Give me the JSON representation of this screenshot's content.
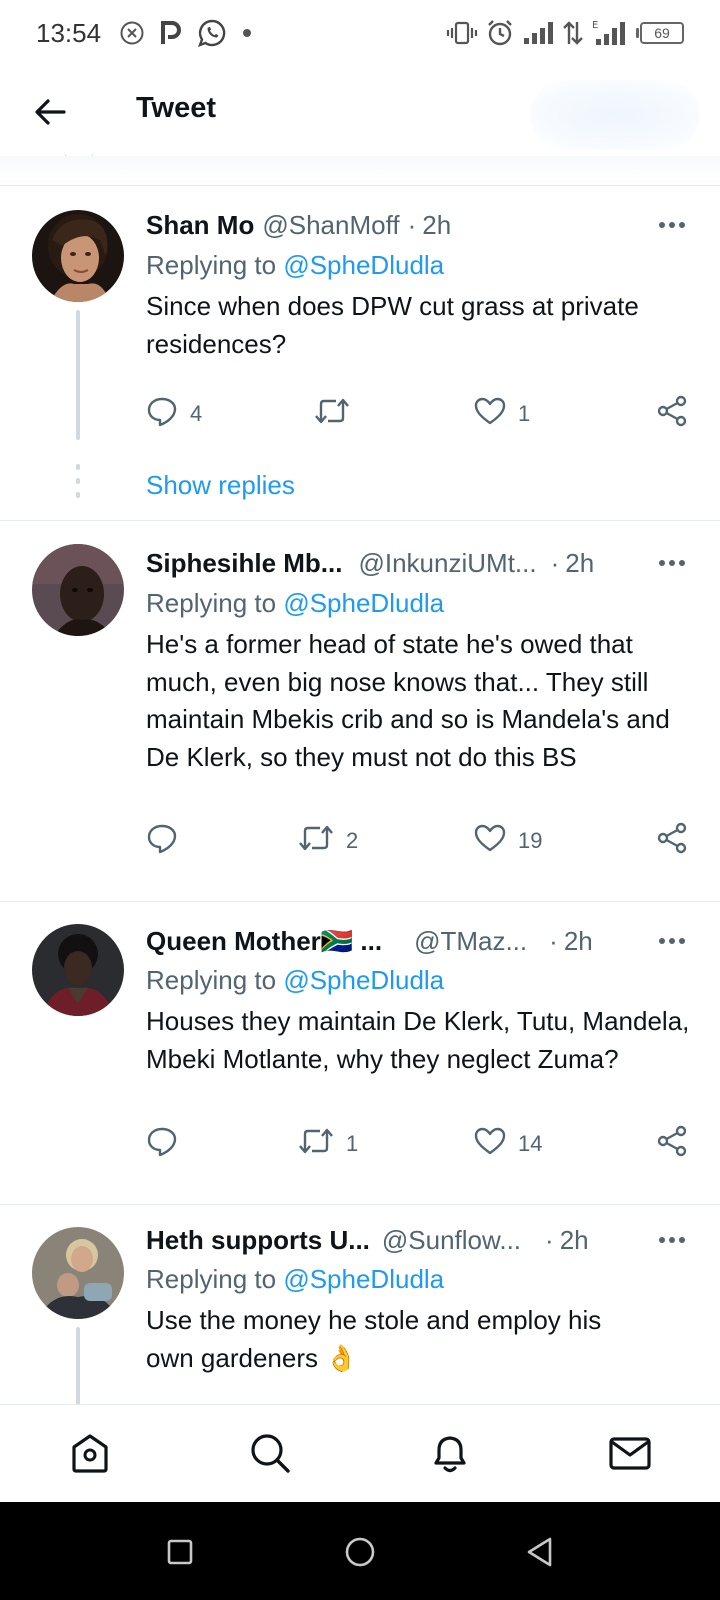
{
  "status_bar": {
    "time": "13:54",
    "battery": "69",
    "icons": [
      "close-circle-icon",
      "p-app-icon",
      "whatsapp-icon",
      "dot-icon",
      "vibrate-icon",
      "alarm-icon",
      "signal-icon",
      "data-arrows-icon",
      "signal-e-icon",
      "battery-icon"
    ]
  },
  "header": {
    "title": "Tweet",
    "back_icon": "arrow-left-icon"
  },
  "tweets": [
    {
      "name": "Shan Mo",
      "handle": "@ShanMoff",
      "time": "2h",
      "replying_prefix": "Replying to",
      "replying_handle": "@SpheDludla",
      "text": "Since when does DPW cut grass at private residences?",
      "replies": "4",
      "retweets": "",
      "likes": "1",
      "show_replies": "Show replies"
    },
    {
      "name": "Siphesihle Mb...",
      "handle": "@InkunziUMt...",
      "time": "2h",
      "replying_prefix": "Replying to",
      "replying_handle": "@SpheDludla",
      "text": "He's a former head of state he's owed that much, even big nose knows that... They still maintain Mbekis crib and so is Mandela's and De Klerk, so they must not do this BS",
      "replies": "",
      "retweets": "2",
      "likes": "19"
    },
    {
      "name": "Queen Mother🇿🇦 ...",
      "handle": "@TMaz...",
      "time": "2h",
      "replying_prefix": "Replying to",
      "replying_handle": "@SpheDludla",
      "text": "Houses they maintain De Klerk, Tutu, Mandela, Mbeki Motlante, why they neglect Zuma?",
      "replies": "",
      "retweets": "1",
      "likes": "14"
    },
    {
      "name": "Heth supports U...",
      "handle": "@Sunflow...",
      "time": "2h",
      "replying_prefix": "Replying to",
      "replying_handle": "@SpheDludla",
      "text": "Use the money he stole and employ his own gardeners 👌"
    }
  ],
  "colors": {
    "accent": "#1d9bf0",
    "secondary_text": "#536471",
    "primary_text": "#0f1419"
  },
  "bottom_nav": [
    "home-icon",
    "search-icon",
    "bell-icon",
    "mail-icon"
  ],
  "system_nav": [
    "recents-square-icon",
    "home-circle-icon",
    "back-triangle-icon"
  ]
}
